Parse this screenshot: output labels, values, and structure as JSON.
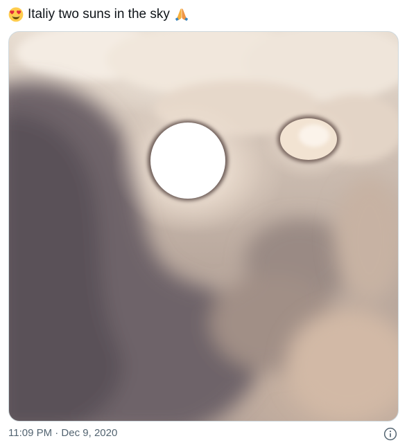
{
  "tweet": {
    "emoji_start": "heart-eyes-emoji",
    "text": "Italiy two suns in the sky",
    "emoji_end": "folded-hands-emoji"
  },
  "media": {
    "subject": "sky-photo"
  },
  "meta": {
    "timestamp": "11:09 PM · Dec 9, 2020"
  },
  "icons": {
    "info": "info-icon"
  },
  "colors": {
    "text": "#0f1419",
    "secondary": "#536471",
    "border": "#cfd9de"
  }
}
